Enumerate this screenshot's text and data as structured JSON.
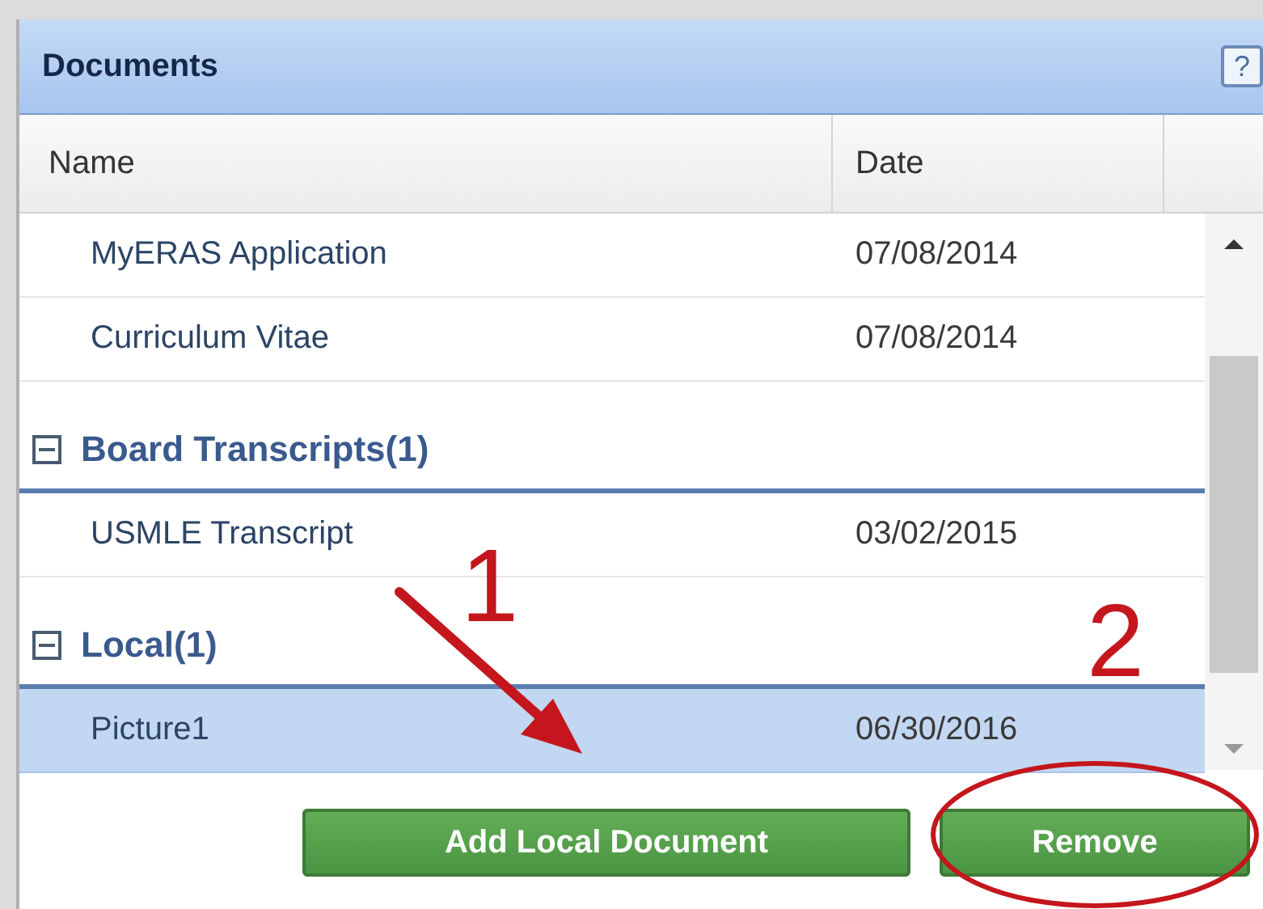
{
  "panel": {
    "title": "Documents",
    "help": "?"
  },
  "table": {
    "columns": [
      "Name",
      "Date"
    ],
    "rows": [
      {
        "name": "MyERAS Application",
        "date": "07/08/2014",
        "selected": false
      },
      {
        "name": "Curriculum Vitae",
        "date": "07/08/2014",
        "selected": false
      }
    ],
    "groups": [
      {
        "label": "Board Transcripts(1)",
        "expanded": true,
        "rows": [
          {
            "name": "USMLE Transcript",
            "date": "03/02/2015",
            "selected": false
          }
        ]
      },
      {
        "label": "Local(1)",
        "expanded": true,
        "rows": [
          {
            "name": "Picture1",
            "date": "06/30/2016",
            "selected": true
          }
        ]
      }
    ]
  },
  "buttons": [
    {
      "label": "Add Local Document"
    },
    {
      "label": "Remove"
    }
  ],
  "annotations": [
    {
      "text": "1"
    },
    {
      "text": "2"
    }
  ]
}
